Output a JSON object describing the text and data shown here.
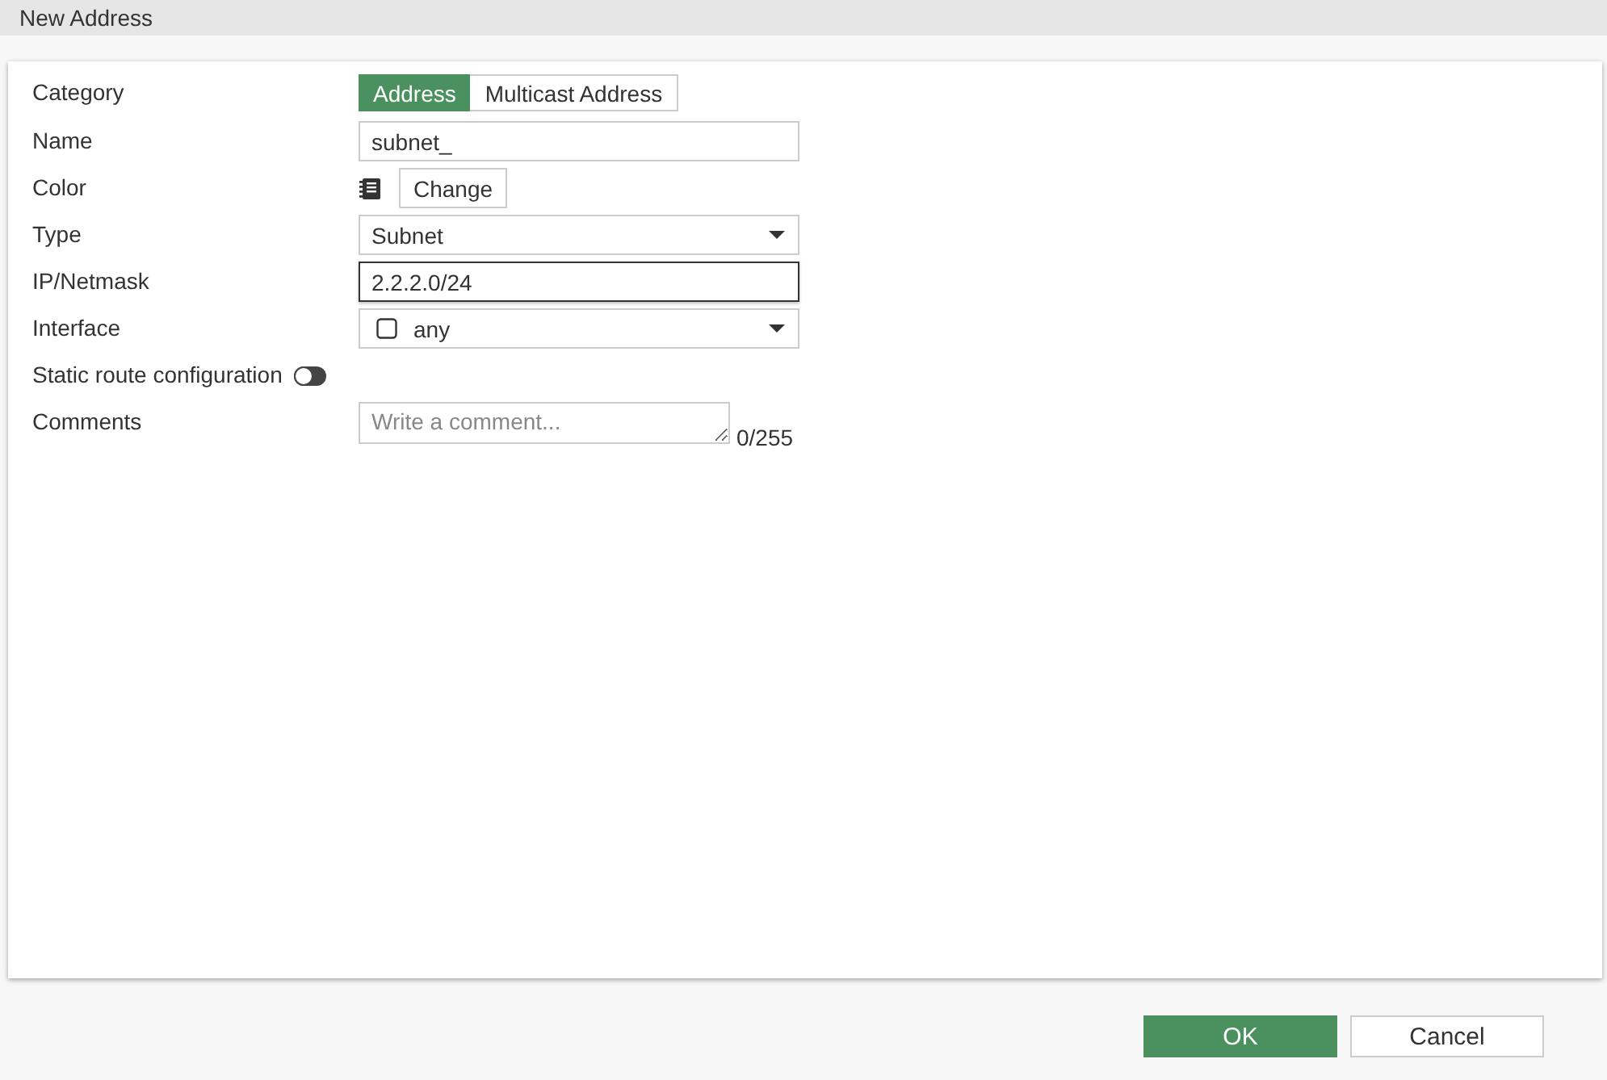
{
  "window": {
    "title": "New Address"
  },
  "form": {
    "rows": [
      {
        "kind": "segmented",
        "label": "Category",
        "options": [
          {
            "label": "Address",
            "selected": true
          },
          {
            "label": "Multicast Address",
            "selected": false
          }
        ]
      },
      {
        "kind": "text",
        "label": "Name",
        "value": "subnet_",
        "focused": false
      },
      {
        "kind": "color",
        "label": "Color",
        "button": "Change"
      },
      {
        "kind": "select",
        "label": "Type",
        "value": "Subnet"
      },
      {
        "kind": "text",
        "label": "IP/Netmask",
        "value": "2.2.2.0/24",
        "focused": true
      },
      {
        "kind": "icon-select",
        "label": "Interface",
        "value": "any"
      },
      {
        "kind": "toggle",
        "label": "Static route configuration",
        "on": false
      },
      {
        "kind": "textarea",
        "label": "Comments",
        "placeholder": "Write a comment...",
        "counter": "0/255"
      }
    ]
  },
  "buttons": [
    {
      "label": "OK",
      "kind": "primary"
    },
    {
      "label": "Cancel",
      "kind": "secondary"
    }
  ]
}
